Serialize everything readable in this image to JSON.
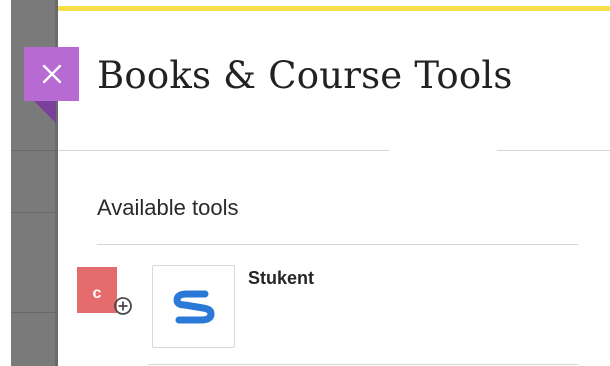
{
  "panel": {
    "title": "Books & Course Tools",
    "close_label": "Close"
  },
  "sections": {
    "available": {
      "heading": "Available tools",
      "tools": [
        {
          "name": "Stukent",
          "icon": "stukent-logo",
          "badge": "c"
        }
      ]
    }
  },
  "colors": {
    "accent_yellow": "#f5e04a",
    "close_tab": "#b66ad2",
    "badge_red": "#e46c6c",
    "stukent_blue": "#2b79d6"
  }
}
